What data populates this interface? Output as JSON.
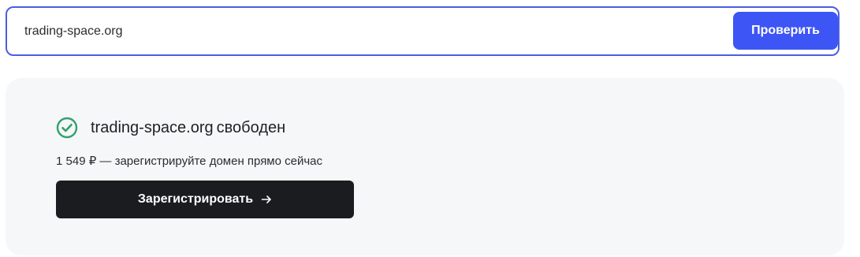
{
  "search": {
    "value": "trading-space.org",
    "button_label": "Проверить"
  },
  "result": {
    "domain": "trading-space.org",
    "status": "свободен",
    "price_text": "1 549 ₽ — зарегистрируйте домен прямо сейчас",
    "register_label": "Зарегистрировать",
    "status_icon": "check-circle-icon",
    "register_icon": "arrow-right-icon"
  },
  "colors": {
    "accent": "#3d55f5",
    "border": "#4a5fe0",
    "success": "#2fa36b",
    "dark_button": "#1b1c1f",
    "card_bg": "#f6f7f9"
  }
}
